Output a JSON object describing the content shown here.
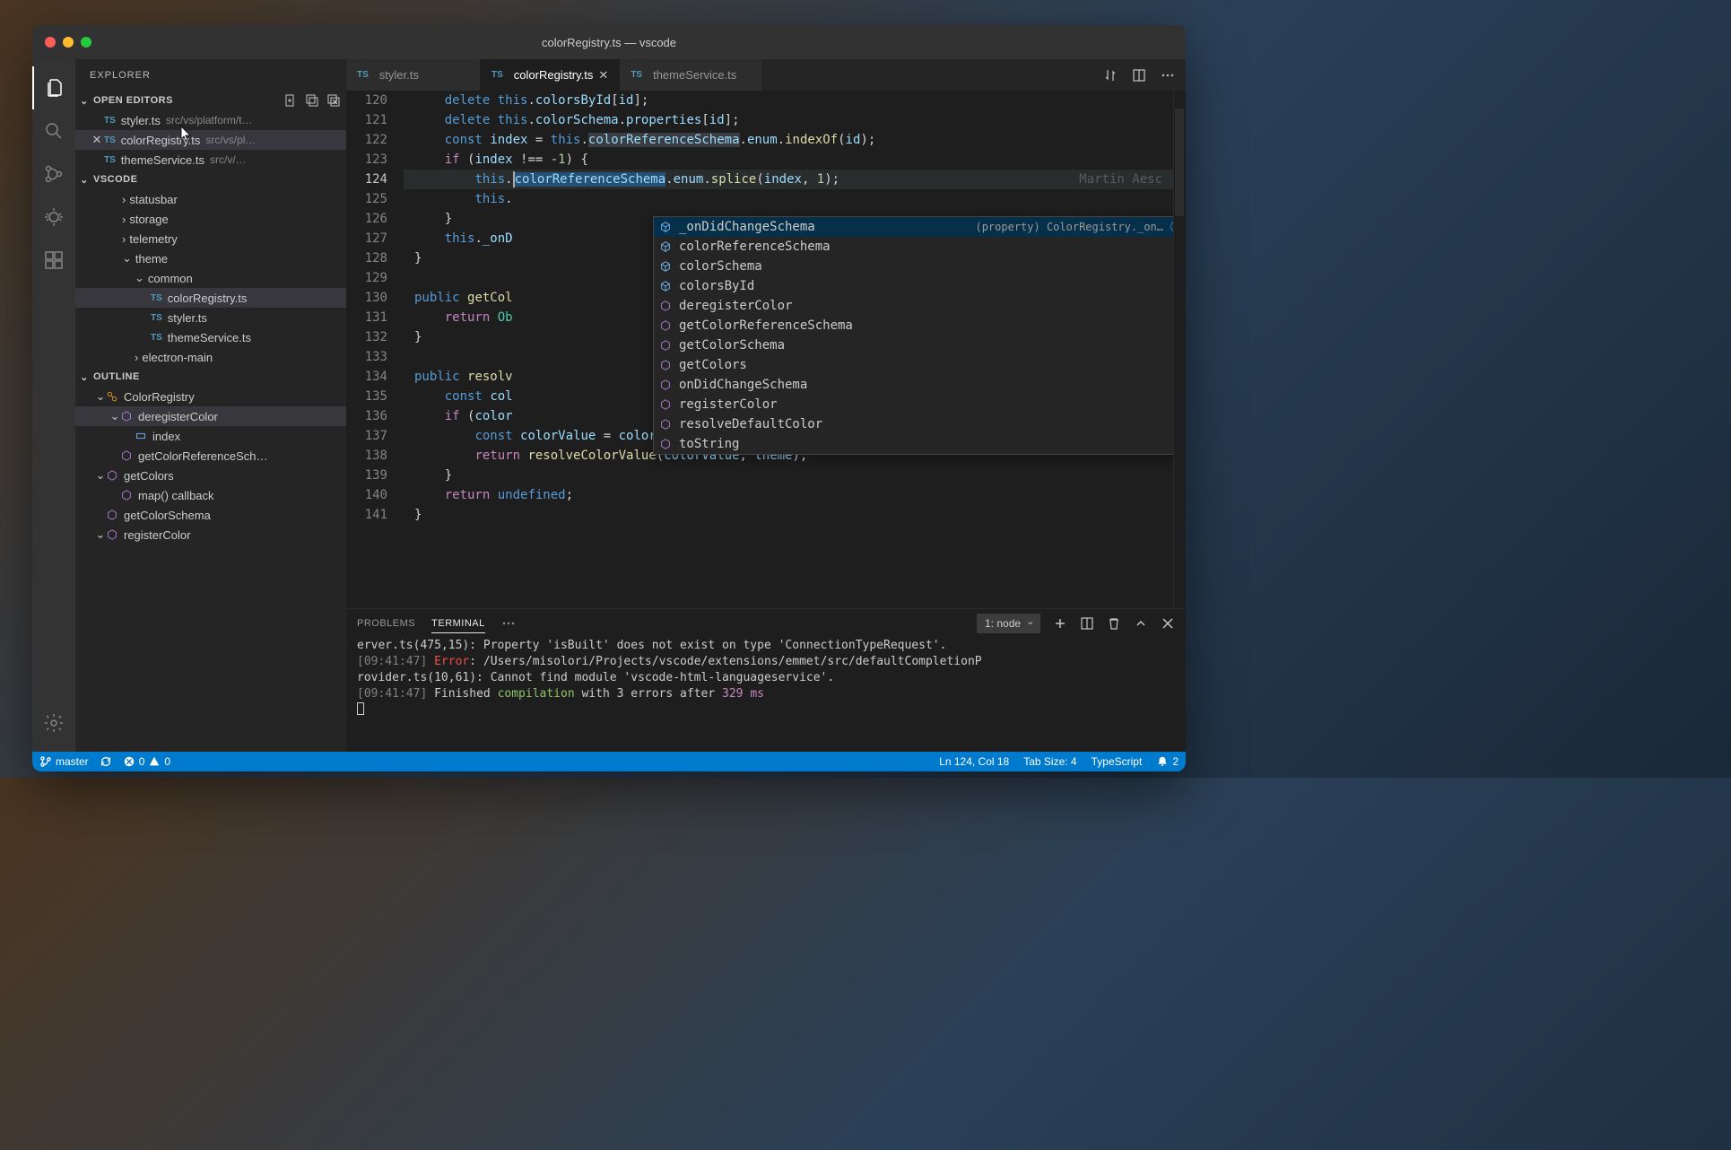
{
  "window": {
    "title": "colorRegistry.ts — vscode"
  },
  "sidebar": {
    "title": "EXPLORER",
    "openEditorsLabel": "OPEN EDITORS",
    "workspaceLabel": "VSCODE",
    "outlineLabel": "OUTLINE",
    "openEditors": [
      {
        "name": "styler.ts",
        "desc": "src/vs/platform/t…",
        "active": false
      },
      {
        "name": "colorRegistry.ts",
        "desc": "src/vs/pl…",
        "active": true
      },
      {
        "name": "themeService.ts",
        "desc": "src/v/…",
        "active": false
      }
    ],
    "tree": [
      {
        "indent": 2,
        "chev": "›",
        "label": "statusbar",
        "type": "folder"
      },
      {
        "indent": 2,
        "chev": "›",
        "label": "storage",
        "type": "folder"
      },
      {
        "indent": 2,
        "chev": "›",
        "label": "telemetry",
        "type": "folder"
      },
      {
        "indent": 2,
        "chev": "⌄",
        "label": "theme",
        "type": "folder"
      },
      {
        "indent": 3,
        "chev": "⌄",
        "label": "common",
        "type": "folder"
      },
      {
        "indent": 4,
        "chev": "",
        "label": "colorRegistry.ts",
        "type": "ts",
        "selected": true
      },
      {
        "indent": 4,
        "chev": "",
        "label": "styler.ts",
        "type": "ts"
      },
      {
        "indent": 4,
        "chev": "",
        "label": "themeService.ts",
        "type": "ts"
      },
      {
        "indent": 3,
        "chev": "›",
        "label": "electron-main",
        "type": "folder"
      }
    ],
    "outline": [
      {
        "indent": 0,
        "chev": "⌄",
        "icon": "class",
        "label": "ColorRegistry"
      },
      {
        "indent": 1,
        "chev": "⌄",
        "icon": "method",
        "label": "deregisterColor",
        "selected": true
      },
      {
        "indent": 2,
        "chev": "",
        "icon": "var",
        "label": "index"
      },
      {
        "indent": 1,
        "chev": "",
        "icon": "method",
        "label": "getColorReferenceSch…"
      },
      {
        "indent": 0,
        "chev": "⌄",
        "icon": "method",
        "label": "getColors"
      },
      {
        "indent": 1,
        "chev": "",
        "icon": "method",
        "label": "map() callback"
      },
      {
        "indent": 0,
        "chev": "",
        "icon": "method",
        "label": "getColorSchema"
      },
      {
        "indent": 0,
        "chev": "⌄",
        "icon": "method",
        "label": "registerColor"
      }
    ]
  },
  "tabs": [
    {
      "name": "styler.ts",
      "active": false
    },
    {
      "name": "colorRegistry.ts",
      "active": true
    },
    {
      "name": "themeService.ts",
      "active": false
    }
  ],
  "editor": {
    "startLine": 120,
    "currentLine": 124,
    "blame": "Martin Aesc",
    "suggest": {
      "detail": "(property) ColorRegistry._on…",
      "items": [
        {
          "icon": "prop",
          "label": "_onDidChangeSchema",
          "selected": true
        },
        {
          "icon": "prop",
          "label": "colorReferenceSchema"
        },
        {
          "icon": "prop",
          "label": "colorSchema"
        },
        {
          "icon": "prop",
          "label": "colorsById"
        },
        {
          "icon": "method",
          "label": "deregisterColor"
        },
        {
          "icon": "method",
          "label": "getColorReferenceSchema"
        },
        {
          "icon": "method",
          "label": "getColorSchema"
        },
        {
          "icon": "method",
          "label": "getColors"
        },
        {
          "icon": "method",
          "label": "onDidChangeSchema"
        },
        {
          "icon": "method",
          "label": "registerColor"
        },
        {
          "icon": "method",
          "label": "resolveDefaultColor"
        },
        {
          "icon": "method",
          "label": "toString"
        }
      ]
    }
  },
  "panel": {
    "tabs": {
      "problems": "PROBLEMS",
      "terminal": "TERMINAL"
    },
    "terminalSelect": "1: node",
    "lines": {
      "l1a": "erver.ts(475,15): Property 'isBuilt' does not exist on type 'ConnectionTypeRequest'.",
      "l2time": "[09:41:47]",
      "l2err": "Error",
      "l2rest": ": /Users/misolori/Projects/vscode/extensions/emmet/src/defaultCompletionP",
      "l3": "rovider.ts(10,61): Cannot find module 'vscode-html-languageservice'.",
      "l4time": "[09:41:47]",
      "l4a": " Finished ",
      "l4b": "compilation",
      "l4c": " with 3 errors after ",
      "l4d": "329 ms"
    }
  },
  "statusbar": {
    "branch": "master",
    "errors": "0",
    "warnings": "0",
    "lncol": "Ln 124, Col 18",
    "tabsize": "Tab Size: 4",
    "language": "TypeScript",
    "bell": "2"
  }
}
